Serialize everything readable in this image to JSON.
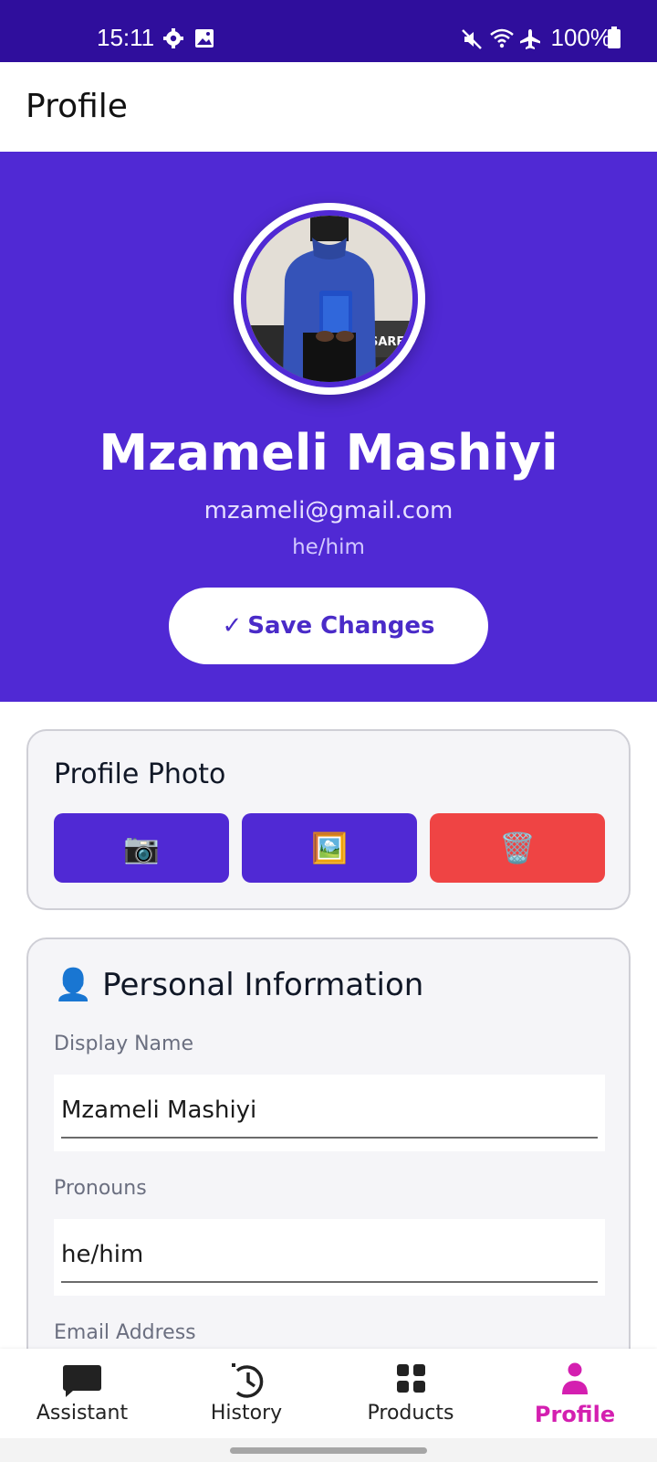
{
  "status_bar": {
    "time": "15:11",
    "battery": "100%",
    "icons": [
      "settings-icon",
      "gallery-icon",
      "mute-icon",
      "wifi-icon",
      "airplane-icon",
      "battery-icon"
    ]
  },
  "app_bar": {
    "title": "Profile"
  },
  "hero": {
    "background_color": "#5029d4",
    "name": "Mzameli Mashiyi",
    "email": "mzameli@gmail.com",
    "pronouns": "he/him",
    "save_button": {
      "icon": "✓",
      "label": "Save Changes"
    }
  },
  "profile_photo_card": {
    "title": "Profile Photo",
    "buttons": [
      {
        "name": "camera",
        "icon": "📷",
        "color": "#5029d4"
      },
      {
        "name": "gallery",
        "icon": "🖼️",
        "color": "#5029d4"
      },
      {
        "name": "delete",
        "icon": "🗑️",
        "color": "#ef4444"
      }
    ]
  },
  "personal_info_card": {
    "icon": "👤",
    "title": "Personal Information",
    "fields": [
      {
        "label": "Display Name",
        "value": "Mzameli Mashiyi"
      },
      {
        "label": "Pronouns",
        "value": "he/him"
      },
      {
        "label": "Email Address",
        "value": ""
      }
    ]
  },
  "bottom_nav": {
    "active_color": "#d41fb0",
    "items": [
      {
        "label": "Assistant",
        "icon": "chat-icon",
        "active": false
      },
      {
        "label": "History",
        "icon": "history-icon",
        "active": false
      },
      {
        "label": "Products",
        "icon": "grid-icon",
        "active": false
      },
      {
        "label": "Profile",
        "icon": "person-icon",
        "active": true
      }
    ]
  }
}
